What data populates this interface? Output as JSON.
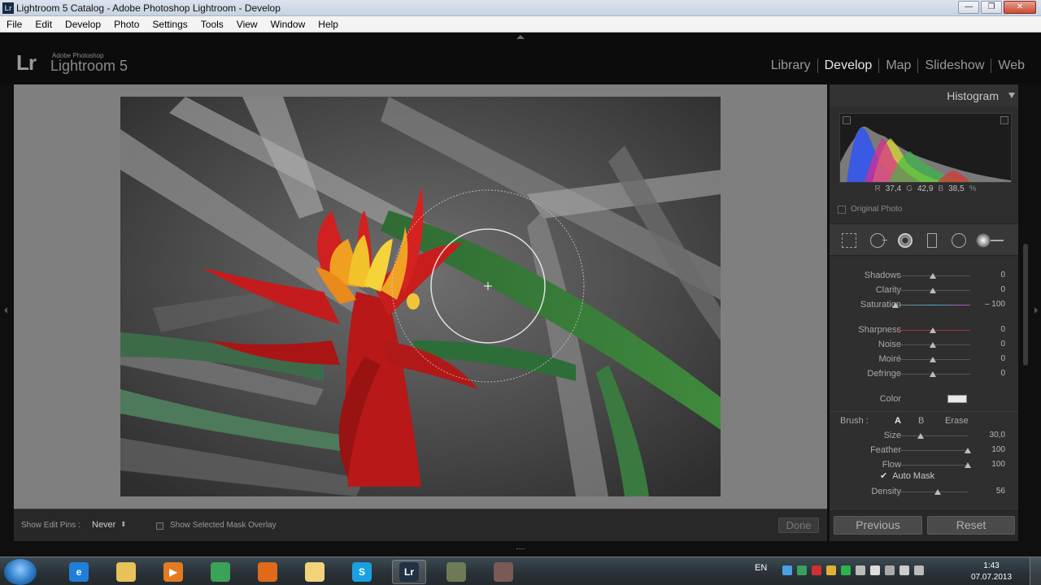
{
  "window": {
    "app_icon": "Lr",
    "title": "Lightroom 5 Catalog - Adobe Photoshop Lightroom - Develop",
    "minimize": "—",
    "maximize": "❐",
    "close": "✕"
  },
  "menu": [
    "File",
    "Edit",
    "Develop",
    "Photo",
    "Settings",
    "Tools",
    "View",
    "Window",
    "Help"
  ],
  "brand": {
    "logo": "Lr",
    "small": "Adobe Photoshop",
    "big": "Lightroom 5"
  },
  "modules": [
    {
      "label": "Library",
      "active": false
    },
    {
      "label": "Develop",
      "active": true
    },
    {
      "label": "Map",
      "active": false
    },
    {
      "label": "Slideshow",
      "active": false
    },
    {
      "label": "Web",
      "active": false
    }
  ],
  "toolbar": {
    "show_edit_pins_label": "Show Edit Pins :",
    "show_edit_pins_value": "Never",
    "updown": "⬍",
    "show_mask_overlay": "Show Selected Mask Overlay",
    "done": "Done"
  },
  "histogram": {
    "title": "Histogram",
    "r_label": "R",
    "r": "37,4",
    "g_label": "G",
    "g": "42,9",
    "b_label": "B",
    "b": "38,5",
    "unit": "%",
    "original_photo": "Original Photo"
  },
  "adjustments": [
    {
      "label": "Shadows",
      "value": "0",
      "pos": 0.5
    },
    {
      "label": "Clarity",
      "value": "0",
      "pos": 0.5
    },
    {
      "label": "Saturation",
      "value": "– 100",
      "pos": 0.0
    },
    {
      "label": "Sharpness",
      "value": "0",
      "pos": 0.5
    },
    {
      "label": "Noise",
      "value": "0",
      "pos": 0.5
    },
    {
      "label": "Moiré",
      "value": "0",
      "pos": 0.5
    },
    {
      "label": "Defringe",
      "value": "0",
      "pos": 0.5
    }
  ],
  "color_label": "Color",
  "brush": {
    "label": "Brush :",
    "a": "A",
    "b": "B",
    "erase": "Erase",
    "settings": [
      {
        "label": "Size",
        "value": "30,0",
        "pos": 0.3
      },
      {
        "label": "Feather",
        "value": "100",
        "pos": 1.0
      },
      {
        "label": "Flow",
        "value": "100",
        "pos": 1.0
      }
    ],
    "auto_mask_check": "✔",
    "auto_mask": "Auto Mask",
    "density": {
      "label": "Density",
      "value": "56",
      "pos": 0.56
    }
  },
  "buttons": {
    "previous": "Previous",
    "reset": "Reset"
  },
  "taskbar": {
    "apps": [
      {
        "name": "ie",
        "glyph": "e",
        "color": "#1f7fd8"
      },
      {
        "name": "explorer",
        "glyph": "",
        "color": "#e8c15a"
      },
      {
        "name": "media-player",
        "glyph": "▶",
        "color": "#e37b22"
      },
      {
        "name": "chrome",
        "glyph": "",
        "color": "#3aa357"
      },
      {
        "name": "firefox",
        "glyph": "",
        "color": "#e06a1a"
      },
      {
        "name": "folder",
        "glyph": "",
        "color": "#f1d37c"
      },
      {
        "name": "skype",
        "glyph": "S",
        "color": "#1aa0e0"
      },
      {
        "name": "lightroom",
        "glyph": "Lr",
        "color": "#223244"
      },
      {
        "name": "app-1",
        "glyph": "",
        "color": "#6e7a55"
      },
      {
        "name": "app-2",
        "glyph": "",
        "color": "#7a5a55"
      }
    ],
    "lang": "EN",
    "time": "1:43",
    "date": "07.07.2013"
  }
}
